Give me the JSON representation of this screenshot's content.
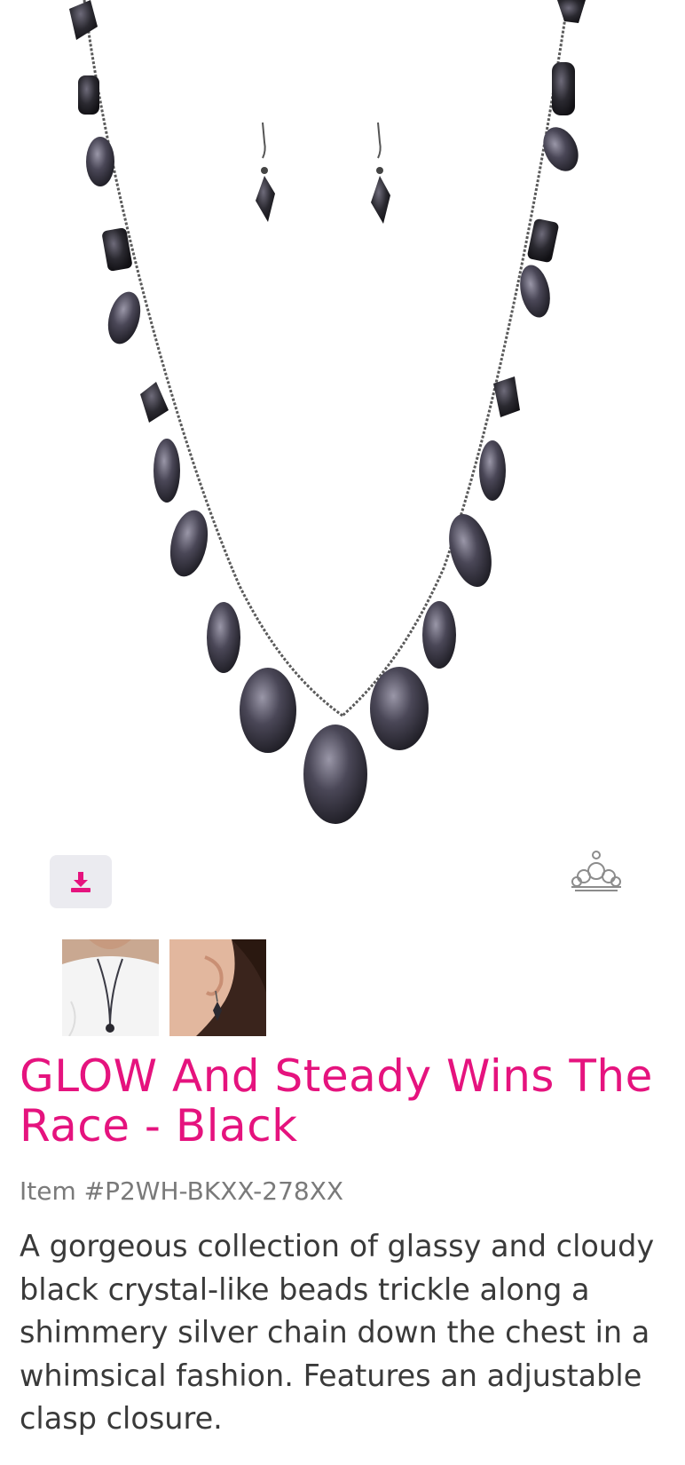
{
  "product": {
    "title": "GLOW And Steady Wins The Race - Black",
    "item_number": "Item #P2WH-BKXX-278XX",
    "description": "A gorgeous collection of glassy and cloudy black crystal-like beads trickle along a shimmery silver chain down the chest in a whimsical fashion. Features an adjustable clasp closure."
  },
  "icons": {
    "download": "download-icon",
    "brand": "crown-logo-icon"
  },
  "colors": {
    "accent": "#e5137e",
    "button_bg": "#ebebf0",
    "text": "#3a3a3a",
    "muted": "#7a7a7a"
  }
}
